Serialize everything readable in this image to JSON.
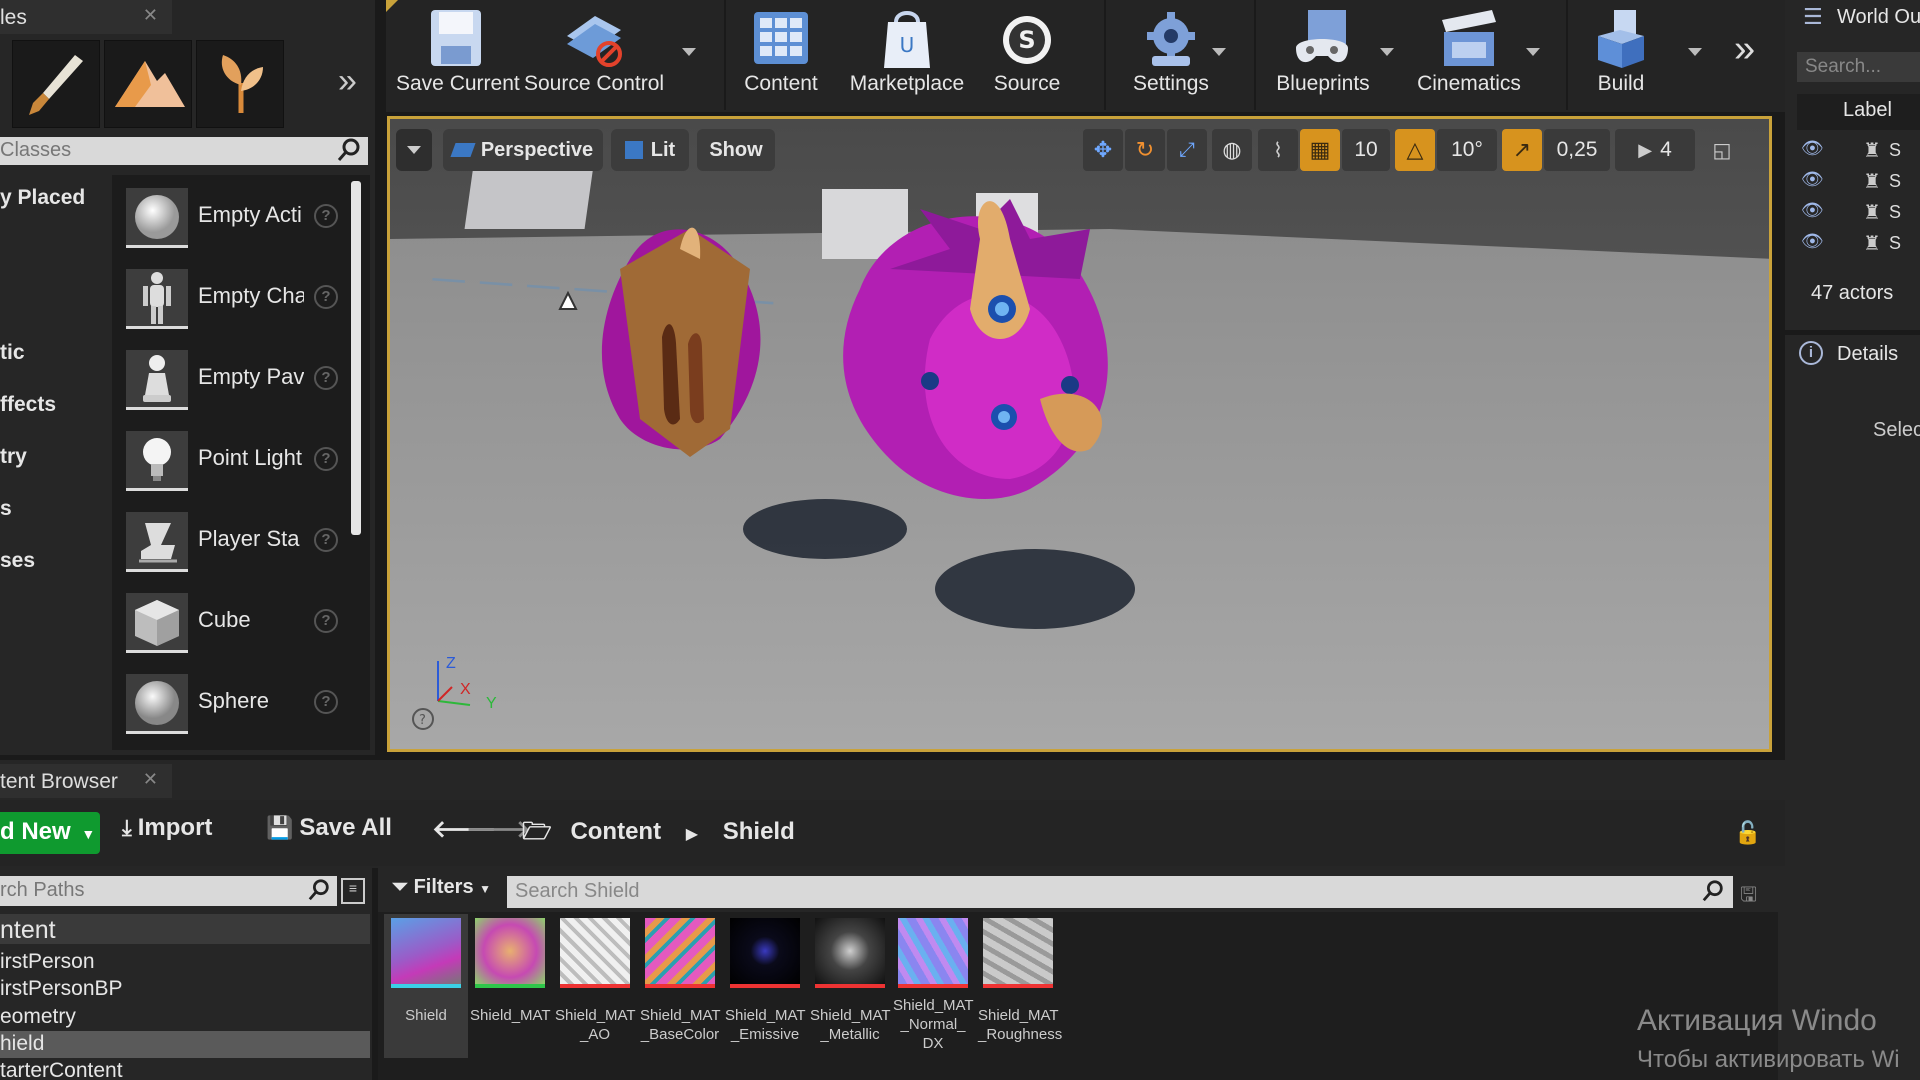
{
  "modes_panel": {
    "tab_title": "les",
    "search_placeholder": "Classes",
    "categories": [
      "y Placed",
      "tic",
      "ffects",
      "try",
      "s",
      "ses"
    ],
    "actors": [
      {
        "label": "Empty Acti",
        "icon": "sphere-white-icon"
      },
      {
        "label": "Empty Cha",
        "icon": "character-icon"
      },
      {
        "label": "Empty Pav",
        "icon": "pawn-icon"
      },
      {
        "label": "Point Light",
        "icon": "bulb-icon"
      },
      {
        "label": "Player Sta",
        "icon": "player-start-icon"
      },
      {
        "label": "Cube",
        "icon": "cube-icon"
      },
      {
        "label": "Sphere",
        "icon": "sphere-icon"
      }
    ]
  },
  "toolbar": {
    "save_current": "Save Current",
    "source_control": "Source Control",
    "content": "Content",
    "marketplace": "Marketplace",
    "source": "Source",
    "settings": "Settings",
    "blueprints": "Blueprints",
    "cinematics": "Cinematics",
    "build": "Build"
  },
  "viewport": {
    "perspective": "Perspective",
    "lit": "Lit",
    "show": "Show",
    "grid_snap": "10",
    "rotation_snap": "10°",
    "scale_snap": "0,25",
    "camera_speed": "4",
    "axis_z": "Z",
    "axis_x": "X",
    "axis_y": "Y"
  },
  "outliner": {
    "title": "World Ou",
    "search_placeholder": "Search...",
    "column_label": "Label",
    "row_marks": [
      "S",
      "S",
      "S",
      "S"
    ],
    "actors_count": "47 actors"
  },
  "details": {
    "title": "Details",
    "hint": "Selec"
  },
  "content_browser": {
    "tab_title": "tent Browser",
    "add_new": "d New",
    "import": "Import",
    "save_all": "Save All",
    "breadcrumb": [
      "Content",
      "Shield"
    ],
    "paths_placeholder": "rch Paths",
    "filters": "Filters",
    "search_placeholder": "Search Shield",
    "tree": [
      "ntent",
      "irstPerson",
      "irstPersonBP",
      "eometry",
      "hield",
      "tarterContent"
    ],
    "assets": [
      {
        "name": "Shield"
      },
      {
        "name": "Shield_MAT"
      },
      {
        "name": "Shield_MAT\n_AO"
      },
      {
        "name": "Shield_MAT\n_BaseColor"
      },
      {
        "name": "Shield_MAT\n_Emissive"
      },
      {
        "name": "Shield_MAT\n_Metallic"
      },
      {
        "name": "Shield_MAT\n_Normal_\nDX"
      },
      {
        "name": "Shield_MAT\n_Roughness"
      }
    ]
  },
  "watermark": {
    "line1": "Активация Windo",
    "line2": "Чтобы активировать Wi"
  },
  "colors": {
    "accent_selection": "#c9a23a",
    "add_new_green": "#0f9a2f",
    "snap_active": "#d7931e"
  }
}
